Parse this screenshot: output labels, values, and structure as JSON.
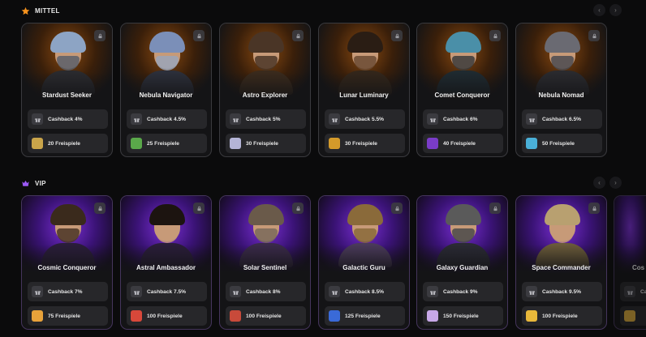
{
  "sections": {
    "mittel": {
      "title": "MITTEL",
      "star_color": "#f7931e",
      "cards": [
        {
          "name": "Stardust Seeker",
          "cashback": "Cashback 4%",
          "spins": "20 Freispiele",
          "hair": "#8da4c4",
          "beard": "#5b5f6a",
          "outfit": "#2a2a2e",
          "game": "#c9a44a"
        },
        {
          "name": "Nebula Navigator",
          "cashback": "Cashback 4.5%",
          "spins": "25 Freispiele",
          "hair": "#7b8fb8",
          "beard": "#9aa4b8",
          "outfit": "#2c2f3a",
          "game": "#5aa84a"
        },
        {
          "name": "Astro Explorer",
          "cashback": "Cashback 5%",
          "spins": "30 Freispiele",
          "hair": "#4a3526",
          "beard": "#4a3526",
          "outfit": "#3a2a1c",
          "game": "#b4b4d6"
        },
        {
          "name": "Lunar Luminary",
          "cashback": "Cashback 5.5%",
          "spins": "30 Freispiele",
          "hair": "#2a1d14",
          "beard": "#6a4a32",
          "outfit": "#33261a",
          "game": "#d49a2a"
        },
        {
          "name": "Comet Conqueror",
          "cashback": "Cashback 6%",
          "spins": "40 Freispiele",
          "hair": "#4a8fa8",
          "beard": "#3b3b3b",
          "outfit": "#1f2a30",
          "game": "#7a3cc8"
        },
        {
          "name": "Nebula Nomad",
          "cashback": "Cashback 6.5%",
          "spins": "50 Freispiele",
          "hair": "#6a6a72",
          "beard": "#4a4a50",
          "outfit": "#2a2a2e",
          "game": "#4ab0d8"
        }
      ]
    },
    "vip": {
      "title": "VIP",
      "crown_color": "#9b59f5",
      "cards": [
        {
          "name": "Cosmic Conqueror",
          "cashback": "Cashback 7%",
          "spins": "75 Freispiele",
          "hair": "#3a2a1c",
          "beard": "#4a3526",
          "outfit": "#2a1d3a",
          "game": "#e8a23a"
        },
        {
          "name": "Astral Ambassador",
          "cashback": "Cashback 7.5%",
          "spins": "100 Freispiele",
          "hair": "#1c1410",
          "beard": "#c79a78",
          "outfit": "#2a1d3a",
          "game": "#d8483a"
        },
        {
          "name": "Solar Sentinel",
          "cashback": "Cashback 8%",
          "spins": "100 Freispiele",
          "hair": "#6a5a4a",
          "beard": "#7a6a5a",
          "outfit": "#3a2a4a",
          "game": "#c84a3a"
        },
        {
          "name": "Galactic Guru",
          "cashback": "Cashback 8.5%",
          "spins": "125 Freispiele",
          "hair": "#8a6a3a",
          "beard": "#8a6a3a",
          "outfit": "#4a3a5a",
          "game": "#3a6ad8"
        },
        {
          "name": "Galaxy Guardian",
          "cashback": "Cashback 9%",
          "spins": "150 Freispiele",
          "hair": "#5a5a5a",
          "beard": "#4a4a4a",
          "outfit": "#2a2a34",
          "game": "#c8a8e8"
        },
        {
          "name": "Space Commander",
          "cashback": "Cashback 9.5%",
          "spins": "100 Freispiele",
          "hair": "#b8a070",
          "beard": "#c79a78",
          "outfit": "#6a5a3a",
          "game": "#e8b83a"
        }
      ],
      "partial_card": {
        "name": "Cos",
        "cashback": "Cas",
        "spins": ""
      }
    }
  }
}
